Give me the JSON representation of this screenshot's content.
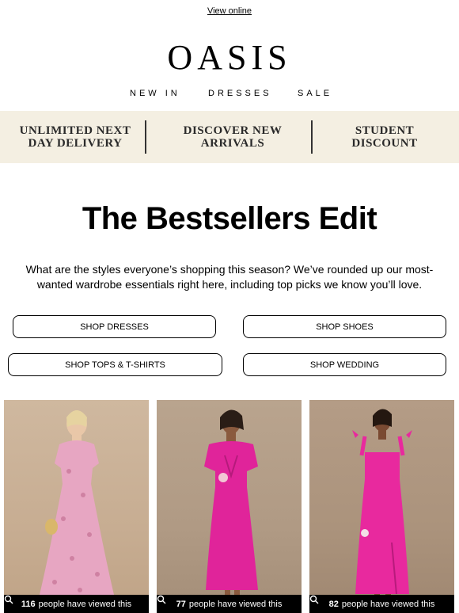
{
  "header": {
    "view_online": "View online",
    "logo": "OASIS",
    "nav": [
      "NEW IN",
      "DRESSES",
      "SALE"
    ]
  },
  "promo": [
    {
      "line1": "UNLIMITED NEXT",
      "line2": "DAY DELIVERY"
    },
    {
      "line1": "DISCOVER NEW",
      "line2": "ARRIVALS"
    },
    {
      "line1": "STUDENT",
      "line2": "DISCOUNT"
    }
  ],
  "main": {
    "headline": "The Bestsellers Edit",
    "intro": "What are the styles everyone’s shopping this season? We’ve rounded up our most-wanted wardrobe essentials right here, including top picks we know you’ll love.",
    "buttons": [
      "SHOP DRESSES",
      "SHOP SHOES",
      "SHOP TOPS & T-SHIRTS",
      "SHOP WEDDING"
    ]
  },
  "products": [
    {
      "views": "116",
      "views_text": "people have viewed this",
      "dress_color": "#e7a6c2"
    },
    {
      "views": "77",
      "views_text": "people have viewed this",
      "dress_color": "#e0249a"
    },
    {
      "views": "82",
      "views_text": "people have viewed this",
      "dress_color": "#e8299e"
    }
  ],
  "colors": {
    "promo_bg": "#f4efe2",
    "button_border": "#000000",
    "viewed_bar": "#000000"
  }
}
